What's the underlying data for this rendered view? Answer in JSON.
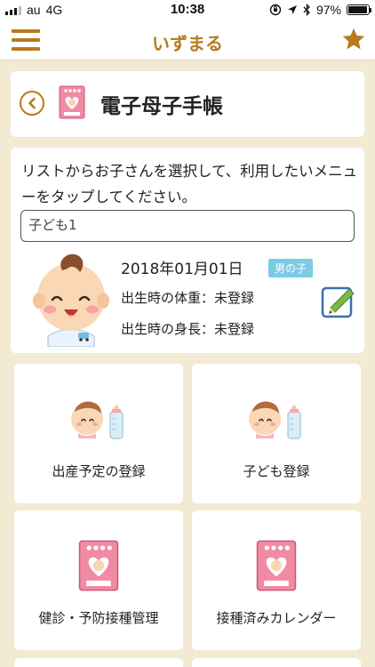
{
  "status_bar": {
    "carrier": "au",
    "network": "4G",
    "time": "10:38",
    "battery": "97%",
    "battery_level": 0.97
  },
  "nav": {
    "title": "いずまる",
    "accent_color": "#b87a1c"
  },
  "header": {
    "title": "電子母子手帳"
  },
  "child_panel": {
    "instructions": "リストからお子さんを選択して、利用したいメニューをタップしてください。",
    "selected_child": "子ども1",
    "birth_date": "2018年01月01日",
    "gender": "男の子",
    "birth_weight": "出生時の体重：未登録",
    "birth_height": "出生時の身長：未登録"
  },
  "menu": [
    {
      "label": "出産予定の登録",
      "icon": "baby-bottle-icon"
    },
    {
      "label": "子ども登録",
      "icon": "baby-bottle-icon"
    },
    {
      "label": "健診・予防接種管理",
      "icon": "mother-child-handbook-icon"
    },
    {
      "label": "接種済みカレンダー",
      "icon": "mother-child-handbook-icon"
    }
  ]
}
